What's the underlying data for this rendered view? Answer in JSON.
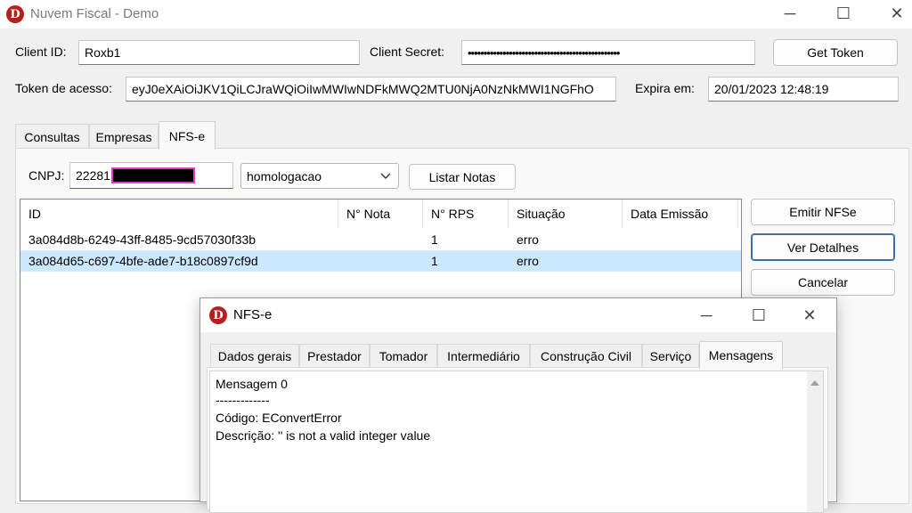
{
  "window": {
    "title": "Nuvem Fiscal - Demo",
    "icon_letter": "D",
    "controls": {
      "minimize": "─",
      "maximize": "☐",
      "close": "✕"
    }
  },
  "credentials": {
    "client_id_label": "Client ID:",
    "client_id_value": "Roxb1",
    "client_secret_label": "Client Secret:",
    "client_secret_value": "••••••••••••••••••••••••••••••••••••••••••••••••",
    "get_token_label": "Get Token",
    "token_label": "Token de acesso:",
    "token_value": "eyJ0eXAiOiJKV1QiLCJraWQiOiIwMWIwNDFkMWQ2MTU0NjA0NzNkMWI1NGFhO",
    "expires_label": "Expira em:",
    "expires_value": "20/01/2023 12:48:19"
  },
  "tabs": [
    "Consultas",
    "Empresas",
    "NFS-e"
  ],
  "active_tab": "NFS-e",
  "nfse": {
    "cnpj_label": "CNPJ:",
    "cnpj_value": "22281",
    "environment": "homologacao",
    "list_button": "Listar Notas",
    "columns": [
      "ID",
      "N° Nota",
      "N° RPS",
      "Situação",
      "Data Emissão"
    ],
    "rows": [
      {
        "id": "3a084d8b-6249-43ff-8485-9cd57030f33b",
        "nota": "",
        "rps": "1",
        "situacao": "erro",
        "data": "",
        "selected": false
      },
      {
        "id": "3a084d65-c697-4bfe-ade7-b18c0897cf9d",
        "nota": "",
        "rps": "1",
        "situacao": "erro",
        "data": "",
        "selected": true
      }
    ],
    "actions": {
      "emit": "Emitir NFSe",
      "details": "Ver Detalhes",
      "cancel": "Cancelar"
    }
  },
  "dialog": {
    "title": "NFS-e",
    "tabs": [
      "Dados gerais",
      "Prestador",
      "Tomador",
      "Intermediário",
      "Construção Civil",
      "Serviço",
      "Mensagens"
    ],
    "active_tab": "Mensagens",
    "messages": [
      "Mensagem 0",
      "-------------",
      "Código: EConvertError",
      "Descrição: '' is not a valid integer value"
    ]
  },
  "colors": {
    "accent": "#3a6fb0",
    "selection": "#cce8ff",
    "redaction": "#000000",
    "redaction_border": "#e040c0",
    "icon_red": "#b3201e"
  }
}
